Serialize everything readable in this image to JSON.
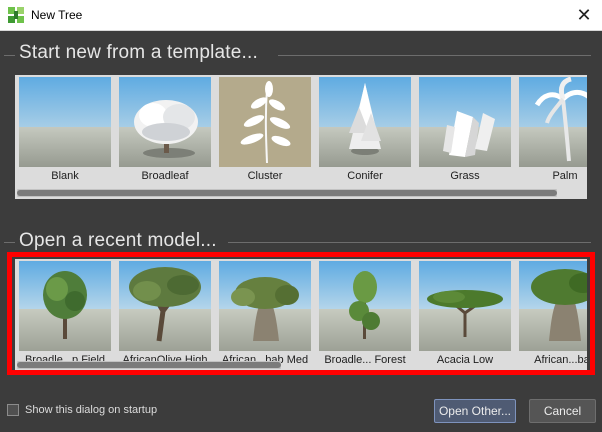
{
  "window": {
    "title": "New Tree",
    "icon": "tree-app-icon",
    "close_glyph": "✕"
  },
  "templates": {
    "heading": "Start new from a template...",
    "items": [
      {
        "label": "Blank",
        "icon": "blank-thumbnail"
      },
      {
        "label": "Broadleaf",
        "icon": "broadleaf-thumbnail"
      },
      {
        "label": "Cluster",
        "icon": "cluster-thumbnail"
      },
      {
        "label": "Conifer",
        "icon": "conifer-thumbnail"
      },
      {
        "label": "Grass",
        "icon": "grass-thumbnail"
      },
      {
        "label": "Palm",
        "icon": "palm-thumbnail"
      }
    ],
    "scroll_position": 0.0
  },
  "recent": {
    "heading": "Open a recent model...",
    "items": [
      {
        "label": "Broadle...p Field",
        "icon": "broadleaf-field-thumbnail"
      },
      {
        "label": "AfricanOlive High",
        "icon": "african-olive-thumbnail"
      },
      {
        "label": "African...bab Med",
        "icon": "african-baobab-thumbnail"
      },
      {
        "label": "Broadle... Forest",
        "icon": "broadleaf-forest-thumbnail"
      },
      {
        "label": "Acacia Low",
        "icon": "acacia-thumbnail"
      },
      {
        "label": "African...bab",
        "icon": "african-baobab-2-thumbnail"
      }
    ],
    "scroll_position": 0.0
  },
  "footer": {
    "startup_label": "Show this dialog on startup",
    "startup_checked": false,
    "open_other_label": "Open Other...",
    "cancel_label": "Cancel"
  },
  "colors": {
    "background": "#3c3c3c",
    "panel": "#dcdcdc",
    "highlight": "#ff0000",
    "primary_button": "#4f5b73",
    "sky": "#6fb4e4",
    "ground": "#a9aca3"
  }
}
